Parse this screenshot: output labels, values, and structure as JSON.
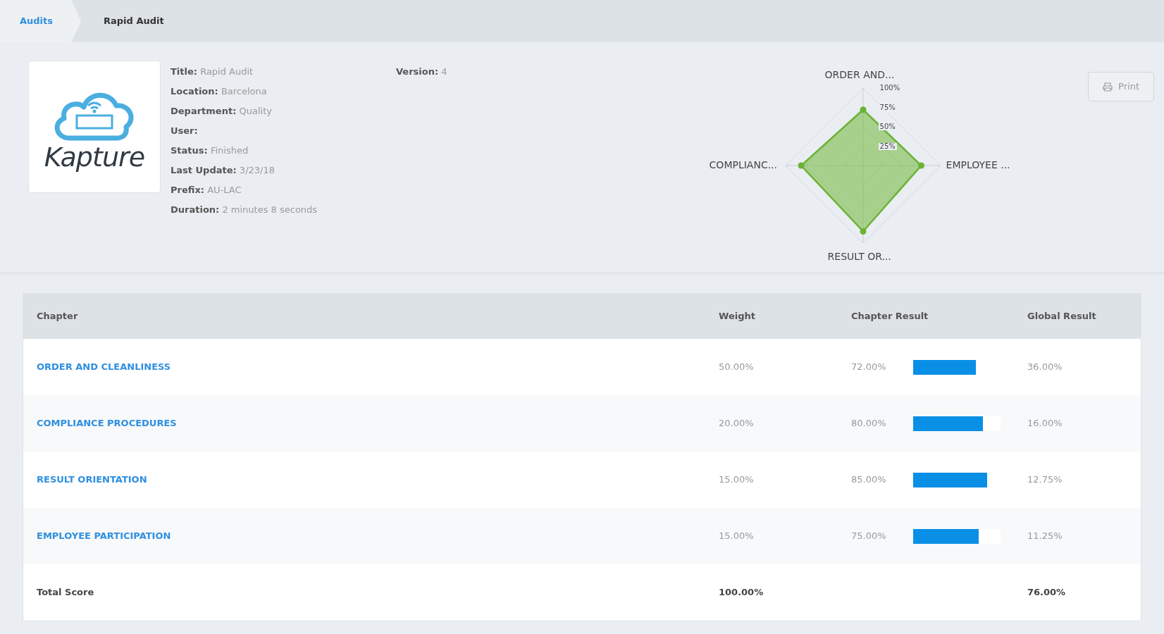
{
  "breadcrumb": [
    {
      "label": "Audits",
      "kind": "link"
    },
    {
      "label": "Rapid Audit",
      "kind": "current"
    }
  ],
  "logo": {
    "wordmark": "Kapture"
  },
  "details": [
    {
      "label": "Title:",
      "value": "Rapid Audit"
    },
    {
      "label": "Location:",
      "value": "Barcelona"
    },
    {
      "label": "Department:",
      "value": "Quality"
    },
    {
      "label": "User:"
    },
    {
      "label": "Status:",
      "value": "Finished"
    },
    {
      "label": "Last Update:",
      "value": "3/23/18"
    },
    {
      "label": "Prefix:",
      "value": "AU-LAC"
    },
    {
      "label": "Duration:",
      "value": "2 minutes 8 seconds"
    }
  ],
  "version": {
    "label": "Version:",
    "value": "4"
  },
  "radar": {
    "axes": [
      "ORDER AND...",
      "EMPLOYEE ...",
      "RESULT OR...",
      "COMPLIANC..."
    ],
    "ticks": [
      "100%",
      "75%",
      "50%",
      "25%"
    ]
  },
  "print_button": {
    "label": "Print"
  },
  "table": {
    "columns": [
      "Chapter",
      "Weight",
      "Chapter Result",
      "Global Result"
    ],
    "rows": [
      {
        "chapter": "ORDER AND CLEANLINESS",
        "weight": "50.00%",
        "result": "72.00%",
        "level": 0.72,
        "global": "36.00%"
      },
      {
        "chapter": "COMPLIANCE PROCEDURES",
        "weight": "20.00%",
        "result": "80.00%",
        "level": 0.8,
        "global": "16.00%"
      },
      {
        "chapter": "RESULT ORIENTATION",
        "weight": "15.00%",
        "result": "85.00%",
        "level": 0.85,
        "global": "12.75%"
      },
      {
        "chapter": "EMPLOYEE PARTICIPATION",
        "weight": "15.00%",
        "result": "75.00%",
        "level": 0.75,
        "global": "11.25%"
      }
    ],
    "total": {
      "label": "Total Score",
      "weight": "100.00%",
      "global": "76.00%"
    }
  }
}
